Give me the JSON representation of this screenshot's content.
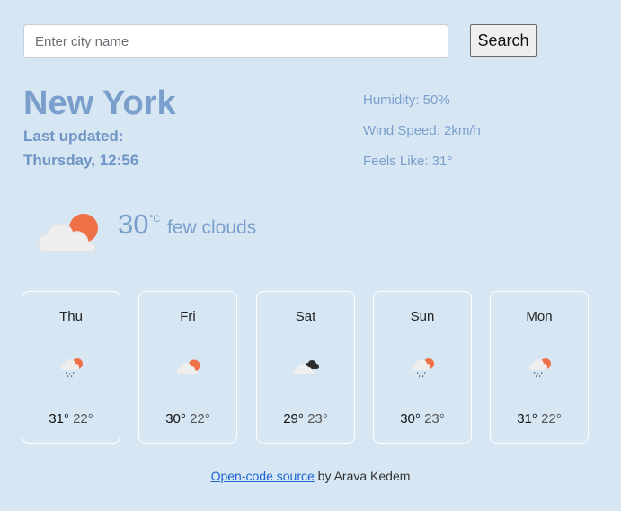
{
  "search": {
    "placeholder": "Enter city name",
    "button_label": "Search"
  },
  "city": "New York",
  "last_updated_label": "Last updated:",
  "last_updated_value": "Thursday, 12:56",
  "details": {
    "humidity": "Humidity: 50%",
    "wind": "Wind Speed: 2km/h",
    "feels_like": "Feels Like: 31°"
  },
  "current": {
    "temperature": "30",
    "unit": "°C",
    "description": "few clouds",
    "icon": "few-clouds-day-icon"
  },
  "forecast": [
    {
      "day": "Thu",
      "high": "31°",
      "low": "22°",
      "icon": "rain-sun-icon"
    },
    {
      "day": "Fri",
      "high": "30°",
      "low": "22°",
      "icon": "cloud-sun-icon"
    },
    {
      "day": "Sat",
      "high": "29°",
      "low": "23°",
      "icon": "dark-clouds-icon"
    },
    {
      "day": "Sun",
      "high": "30°",
      "low": "23°",
      "icon": "rain-sun-icon"
    },
    {
      "day": "Mon",
      "high": "31°",
      "low": "22°",
      "icon": "rain-sun-icon"
    }
  ],
  "footer": {
    "link_text": "Open-code source",
    "suffix": " by Arava Kedem"
  },
  "colors": {
    "background": "#d6e6f3",
    "accent": "#7a9fcc",
    "sun": "#f07148",
    "card_border": "#ffffff",
    "link": "#1e63cf"
  }
}
